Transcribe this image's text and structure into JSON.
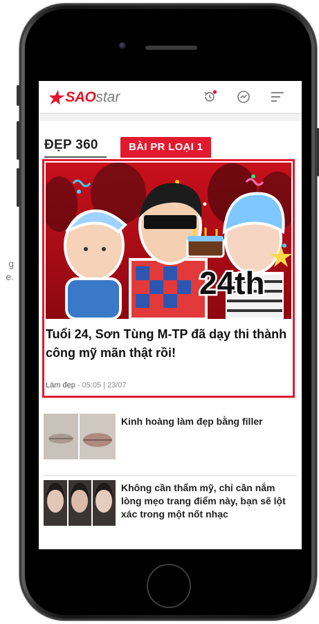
{
  "side_caption": [
    "g",
    "e."
  ],
  "app": {
    "logo": {
      "mark": "★",
      "sao": "SAO",
      "star": "star"
    },
    "header_icons": [
      "history-icon",
      "trending-icon",
      "menu-icon"
    ],
    "notification_color": "#e2172d"
  },
  "section": {
    "title": "ĐẸP 360",
    "badge": "BÀI PR LOẠI 1"
  },
  "featured": {
    "hero_text": "24th",
    "title": "Tuổi 24, Sơn Tùng M-TP đã dạy thi thành công mỹ mãn thật rồi!",
    "category": "Làm đẹp",
    "separator": " - ",
    "time": "05:05 | 23/07"
  },
  "articles": [
    {
      "title": "Kinh hoàng làm đẹp bằng filler"
    },
    {
      "title": "Không cần thẩm mỹ, chỉ cần nắm lòng mẹo trang điểm này, bạn sẽ lột xác trong một nốt nhạc"
    }
  ],
  "colors": {
    "brand_red": "#e2172d",
    "badge_red": "#e21a30",
    "hero_red": "#b50d17"
  }
}
